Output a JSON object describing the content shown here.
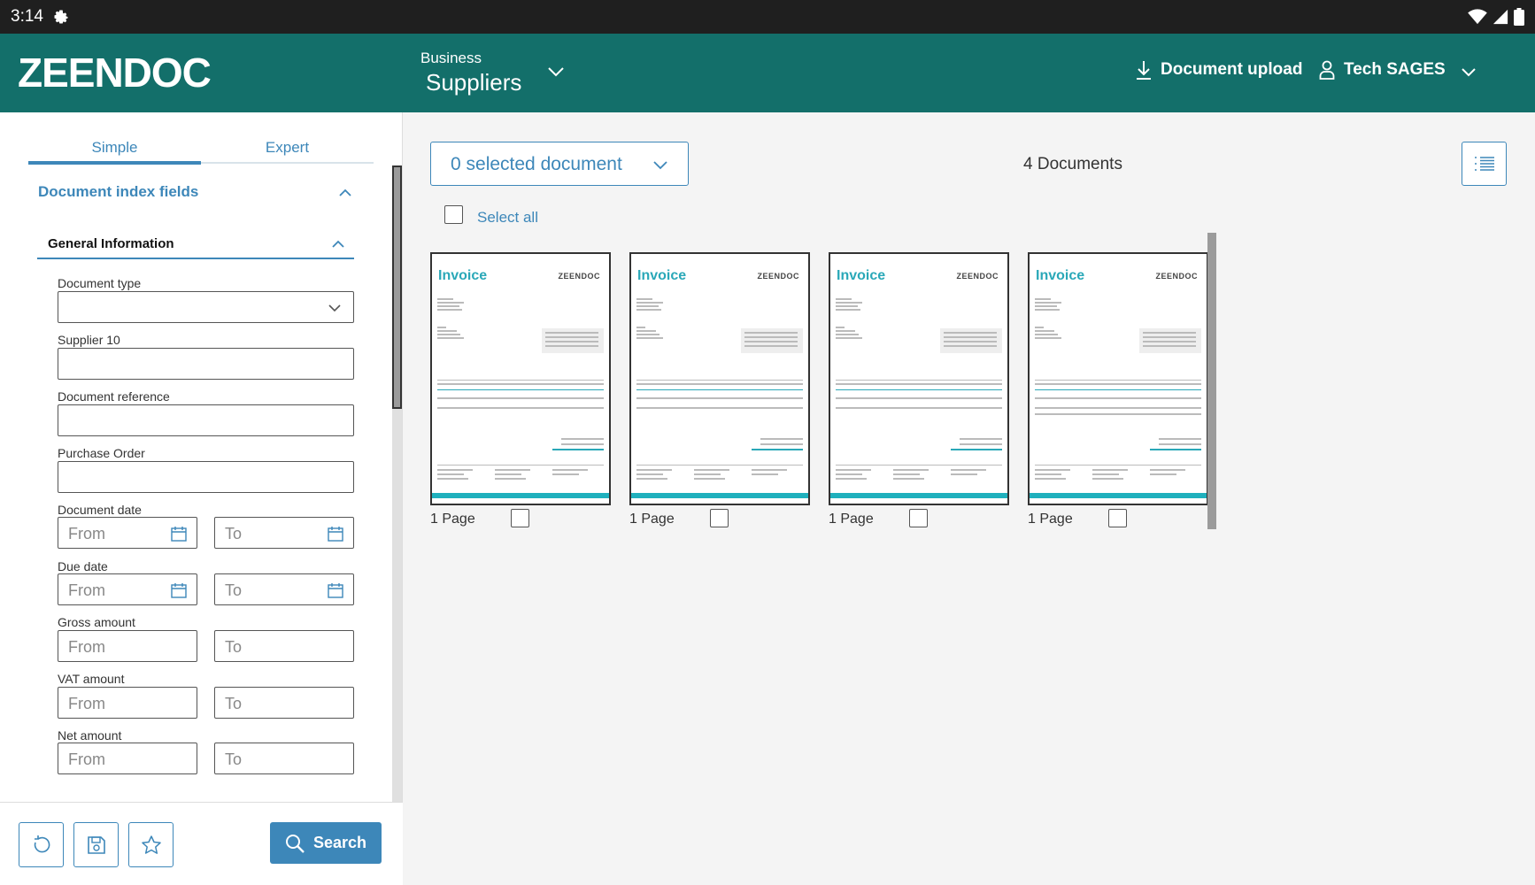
{
  "status_bar": {
    "time": "3:14"
  },
  "header": {
    "logo_text": "ZEENDOC",
    "business_label": "Business",
    "business_value": "Suppliers",
    "upload_label": "Document upload",
    "user_name": "Tech SAGES",
    "brand_color": "#136f6a"
  },
  "sidebar": {
    "tabs": [
      {
        "label": "Simple"
      },
      {
        "label": "Expert"
      }
    ],
    "section_title": "Document index fields",
    "group_title": "General Information",
    "fields": {
      "document_type": {
        "label": "Document type",
        "value": ""
      },
      "supplier": {
        "label": "Supplier 10",
        "value": ""
      },
      "document_reference": {
        "label": "Document reference",
        "value": ""
      },
      "purchase_order": {
        "label": "Purchase Order",
        "value": ""
      },
      "document_date": {
        "label": "Document date",
        "from": "From",
        "to": "To"
      },
      "due_date": {
        "label": "Due date",
        "from": "From",
        "to": "To"
      },
      "gross_amount": {
        "label": "Gross amount",
        "from": "From",
        "to": "To"
      },
      "vat_amount": {
        "label": "VAT amount",
        "from": "From",
        "to": "To"
      },
      "net_amount": {
        "label": "Net amount",
        "from": "From",
        "to": "To"
      }
    },
    "search_label": "Search",
    "accent_color": "#3d87b9"
  },
  "main": {
    "selected_label": "0 selected document",
    "document_count": "4 Documents",
    "select_all_label": "Select all",
    "documents": [
      {
        "title": "Invoice",
        "logo": "ZEENDOC",
        "pages": "1 Page"
      },
      {
        "title": "Invoice",
        "logo": "ZEENDOC",
        "pages": "1 Page"
      },
      {
        "title": "Invoice",
        "logo": "ZEENDOC",
        "pages": "1 Page"
      },
      {
        "title": "Invoice",
        "logo": "ZEENDOC",
        "pages": "1 Page"
      }
    ]
  }
}
